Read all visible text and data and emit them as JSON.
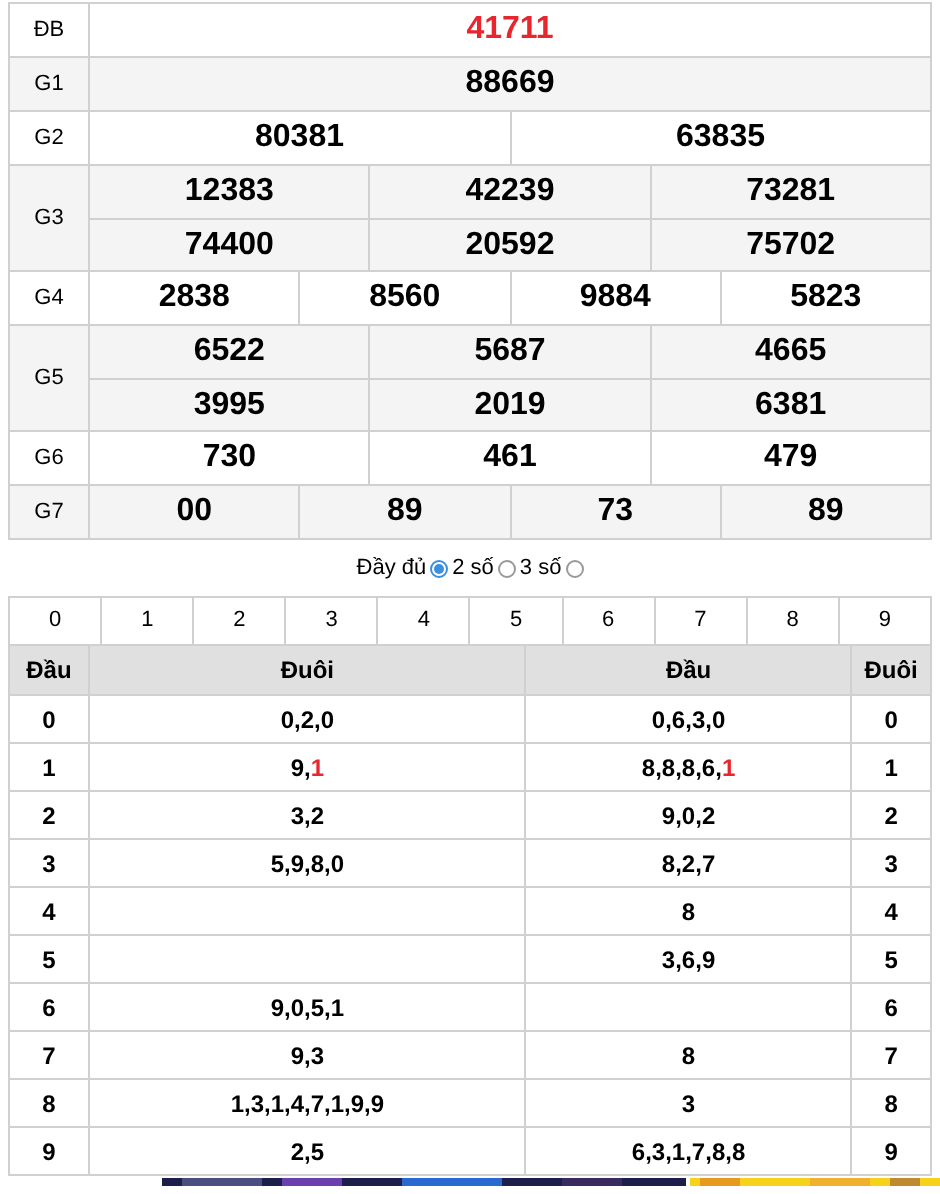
{
  "prizes": [
    {
      "label": "ĐB",
      "special": true,
      "rows": [
        [
          "41711"
        ]
      ]
    },
    {
      "label": "G1",
      "special": false,
      "rows": [
        [
          "88669"
        ]
      ]
    },
    {
      "label": "G2",
      "special": false,
      "rows": [
        [
          "80381",
          "63835"
        ]
      ]
    },
    {
      "label": "G3",
      "special": false,
      "rows": [
        [
          "12383",
          "42239",
          "73281"
        ],
        [
          "74400",
          "20592",
          "75702"
        ]
      ]
    },
    {
      "label": "G4",
      "special": false,
      "rows": [
        [
          "2838",
          "8560",
          "9884",
          "5823"
        ]
      ]
    },
    {
      "label": "G5",
      "special": false,
      "rows": [
        [
          "6522",
          "5687",
          "4665"
        ],
        [
          "3995",
          "2019",
          "6381"
        ]
      ]
    },
    {
      "label": "G6",
      "special": false,
      "rows": [
        [
          "730",
          "461",
          "479"
        ]
      ]
    },
    {
      "label": "G7",
      "special": false,
      "rows": [
        [
          "00",
          "89",
          "73",
          "89"
        ]
      ]
    }
  ],
  "display_options": [
    {
      "label": "Đầy đủ",
      "selected": true
    },
    {
      "label": "2 số",
      "selected": false
    },
    {
      "label": "3 số",
      "selected": false
    }
  ],
  "digit_filter": [
    "0",
    "1",
    "2",
    "3",
    "4",
    "5",
    "6",
    "7",
    "8",
    "9"
  ],
  "loto_table": {
    "columns": [
      "Đầu",
      "Đuôi",
      "Đầu",
      "Đuôi"
    ],
    "rows": [
      {
        "head": "0",
        "tails": [
          {
            "text": "0,2,0",
            "special": false
          }
        ],
        "heads": [
          {
            "text": "0,6,3,0",
            "special": false
          }
        ],
        "tail": "0"
      },
      {
        "head": "1",
        "tails": [
          {
            "text": "9,",
            "special": false
          },
          {
            "text": "1",
            "special": true
          }
        ],
        "heads": [
          {
            "text": "8,8,8,6,",
            "special": false
          },
          {
            "text": "1",
            "special": true
          }
        ],
        "tail": "1"
      },
      {
        "head": "2",
        "tails": [
          {
            "text": "3,2",
            "special": false
          }
        ],
        "heads": [
          {
            "text": "9,0,2",
            "special": false
          }
        ],
        "tail": "2"
      },
      {
        "head": "3",
        "tails": [
          {
            "text": "5,9,8,0",
            "special": false
          }
        ],
        "heads": [
          {
            "text": "8,2,7",
            "special": false
          }
        ],
        "tail": "3"
      },
      {
        "head": "4",
        "tails": [],
        "heads": [
          {
            "text": "8",
            "special": false
          }
        ],
        "tail": "4"
      },
      {
        "head": "5",
        "tails": [],
        "heads": [
          {
            "text": "3,6,9",
            "special": false
          }
        ],
        "tail": "5"
      },
      {
        "head": "6",
        "tails": [
          {
            "text": "9,0,5,1",
            "special": false
          }
        ],
        "heads": [],
        "tail": "6"
      },
      {
        "head": "7",
        "tails": [
          {
            "text": "9,3",
            "special": false
          }
        ],
        "heads": [
          {
            "text": "8",
            "special": false
          }
        ],
        "tail": "7"
      },
      {
        "head": "8",
        "tails": [
          {
            "text": "1,3,1,4,7,1,9,9",
            "special": false
          }
        ],
        "heads": [
          {
            "text": "3",
            "special": false
          }
        ],
        "tail": "8"
      },
      {
        "head": "9",
        "tails": [
          {
            "text": "2,5",
            "special": false
          }
        ],
        "heads": [
          {
            "text": "6,3,1,7,8,8",
            "special": false
          }
        ],
        "tail": "9"
      }
    ]
  }
}
